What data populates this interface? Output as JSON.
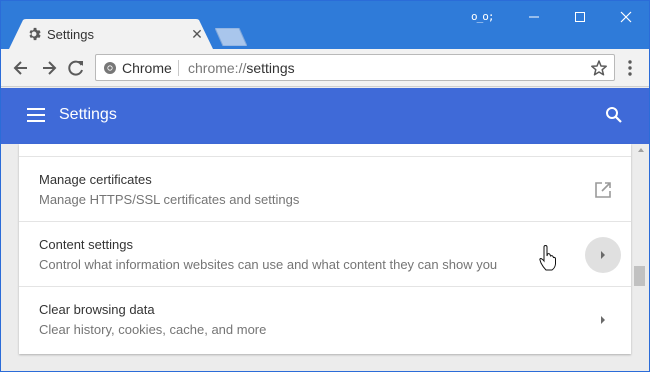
{
  "window": {
    "tab_title": "Settings",
    "profile_label": "o_o;",
    "colors": {
      "frame": "#2f7bd9",
      "appbar": "#3f6ad8"
    }
  },
  "toolbar": {
    "security_chip": "Chrome",
    "url_scheme": "chrome://",
    "url_path": "settings"
  },
  "appbar": {
    "title": "Settings"
  },
  "settings": {
    "rows": [
      {
        "title": "Manage certificates",
        "subtitle": "Manage HTTPS/SSL certificates and settings",
        "action_icon": "open-in-new-icon"
      },
      {
        "title": "Content settings",
        "subtitle": "Control what information websites can use and what content they can show you",
        "action_icon": "chevron-right-icon"
      },
      {
        "title": "Clear browsing data",
        "subtitle": "Clear history, cookies, cache, and more",
        "action_icon": "chevron-right-icon"
      }
    ]
  }
}
